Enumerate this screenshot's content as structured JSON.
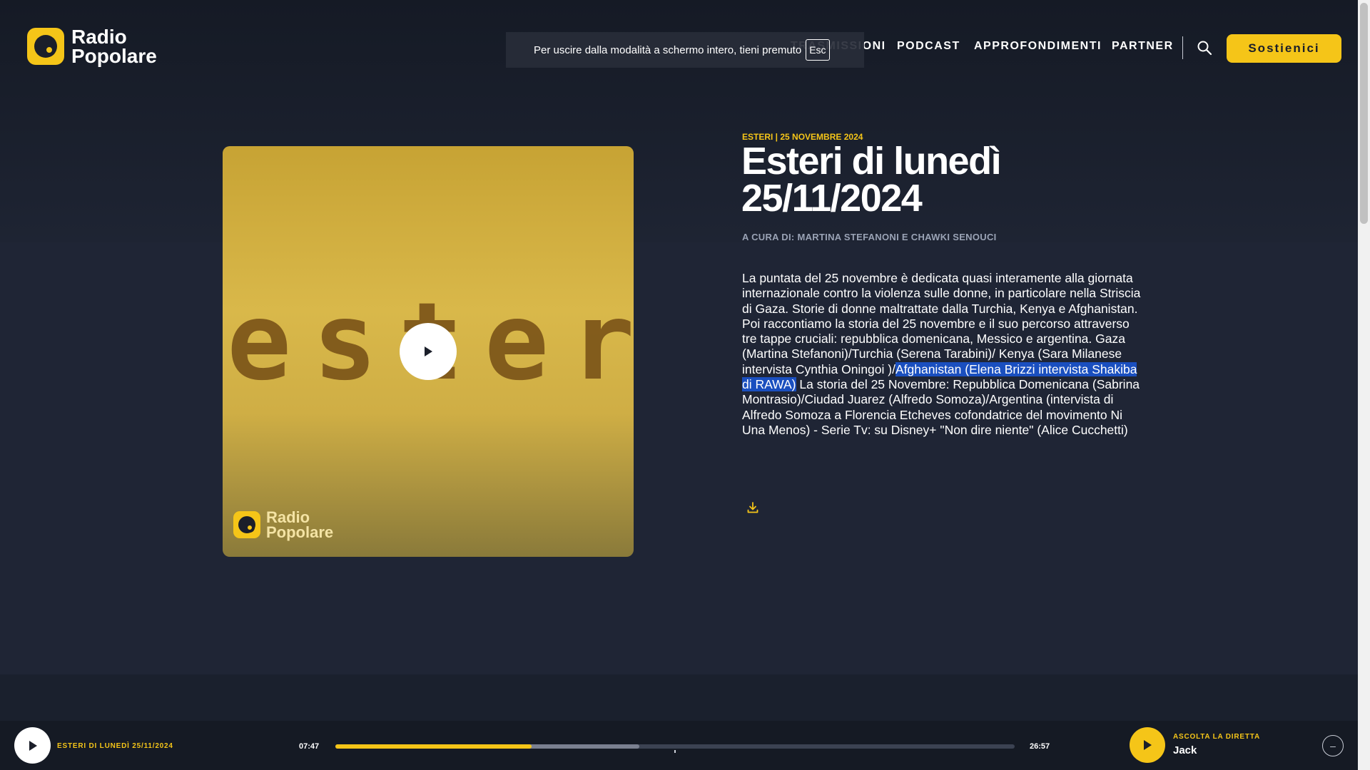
{
  "brand": {
    "line1": "Radio",
    "line2": "Popolare",
    "color": "#f5c518"
  },
  "nav": {
    "items": [
      {
        "id": "programmi-partial",
        "label": "TRASMISSIONI"
      },
      {
        "id": "podcast",
        "label": "PODCAST"
      },
      {
        "id": "approfondimenti",
        "label": "APPROFONDIMENTI"
      },
      {
        "id": "partner",
        "label": "PARTNER"
      }
    ],
    "search_icon": "search-icon",
    "cta_label": "Sostienici"
  },
  "fullscreen_notice": {
    "text": "Per uscire dalla modalità a schermo intero, tieni premuto",
    "key": "Esc"
  },
  "cover": {
    "word": "esteri",
    "logo_line1": "Radio",
    "logo_line2": "Popolare"
  },
  "article": {
    "kicker": "ESTERI | 25 NOVEMBRE 2024",
    "title": "Esteri di lunedì 25/11/2024",
    "byline": "A CURA DI: MARTINA STEFANONI E CHAWKI SENOUCI",
    "desc_before": "La puntata del 25 novembre è dedicata quasi interamente alla giornata internazionale contro la violenza sulle donne, in particolare nella Striscia di Gaza. Storie di donne maltrattate dalla Turchia, Kenya e Afghanistan. Poi raccontiamo la storia del 25 novembre e il suo percorso attraverso tre tappe cruciali: repubblica domenicana, Messico e argentina. Gaza (Martina Stefanoni)/Turchia (Serena Tarabini)/ Kenya (Sara Milanese intervista Cynthia Oningoi )/",
    "desc_highlight": "Afghanistan (Elena Brizzi intervista Shakiba di RAWA)",
    "desc_after": " La storia del 25 Novembre: Repubblica Domenicana (Sabrina Montrasio)/Ciudad Juarez (Alfredo Somoza)/Argentina (intervista di Alfredo Somoza a Florencia Etcheves cofondatrice del movimento Ni Una Menos) - Serie Tv: su Disney+ \"Non dire niente\" (Alice Cucchetti)",
    "download_icon": "download-icon"
  },
  "player": {
    "title": "ESTERI DI LUNEDÌ 25/11/2024",
    "elapsed": "07:47",
    "duration": "26:57",
    "progress": 0.289,
    "buffered": 0.448,
    "live_label": "ASCOLTA LA DIRETTA",
    "live_name": "Jack",
    "collapse_icon": "minus-icon"
  }
}
